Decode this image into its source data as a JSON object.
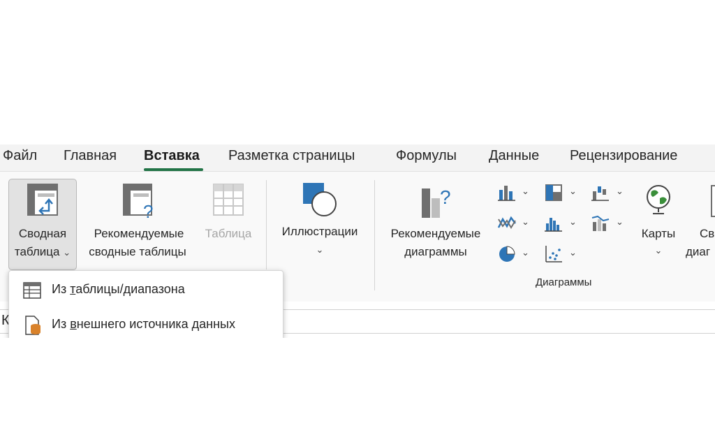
{
  "tabs": [
    {
      "label": "Файл"
    },
    {
      "label": "Главная"
    },
    {
      "label": "Вставка"
    },
    {
      "label": "Разметка страницы"
    },
    {
      "label": "Формулы"
    },
    {
      "label": "Данные"
    },
    {
      "label": "Рецензирование"
    }
  ],
  "ribbon": {
    "pivot": {
      "line1": "Сводная",
      "line2": "таблица"
    },
    "recommended_pivot": {
      "line1": "Рекомендуемые",
      "line2": "сводные таблицы"
    },
    "table": {
      "label": "Таблица",
      "state": "disabled"
    },
    "illustrations": {
      "label": "Иллюстрации"
    },
    "recommended_charts": {
      "line1": "Рекомендуемые",
      "line2": "диаграммы"
    },
    "maps": {
      "label": "Карты"
    },
    "next_cut": {
      "line1": "Св",
      "line2": "диаг"
    },
    "charts_group_label": "Диаграммы",
    "chart_icons": [
      "column-chart-icon",
      "hierarchy-chart-icon",
      "waterfall-chart-icon",
      "line-chart-icon",
      "statistic-chart-icon",
      "combo-chart-icon",
      "pie-chart-icon",
      "scatter-chart-icon"
    ]
  },
  "formula_bar": {
    "cut_text": "К"
  },
  "dropdown": {
    "items": [
      {
        "prefix": "Из ",
        "accel": "т",
        "rest": "аблицы/диапазона",
        "icon": "table-range-icon"
      },
      {
        "prefix": "Из ",
        "accel": "в",
        "rest": "нешнего источника данных",
        "icon": "external-source-icon"
      }
    ]
  },
  "colors": {
    "accent": "#217346",
    "icon_blue": "#2e75b6",
    "icon_gray": "#6f6f6f",
    "orange": "#d9822b"
  }
}
